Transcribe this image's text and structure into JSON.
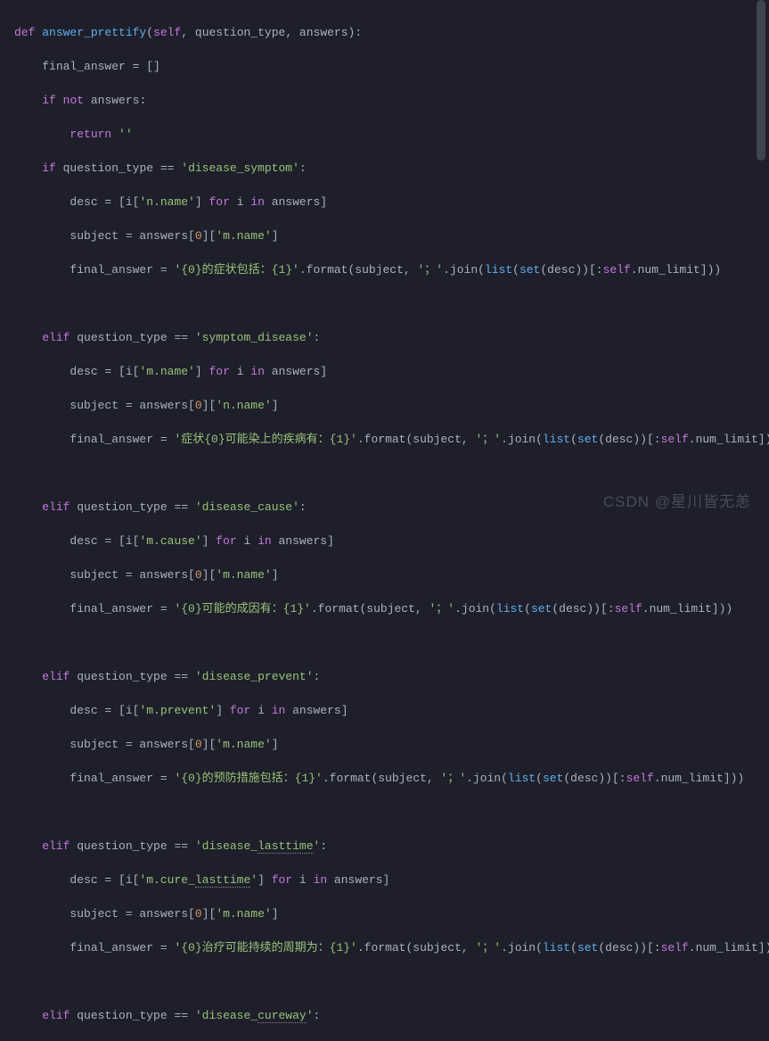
{
  "watermark": "CSDN @星川皆无恙",
  "code": {
    "def": "def",
    "fn": "answer_prettify",
    "params": {
      "self": "self",
      "qt": "question_type",
      "ans": "answers"
    },
    "l2": "final_answer = []",
    "l3a": "if",
    "l3b": "not",
    "l3c": " answers:",
    "l4a": "return",
    "l4b": "''",
    "if": "if",
    "elif": "elif",
    "case1": {
      "qt": "'disease_symptom'",
      "desc_a": "desc = [i[",
      "key": "'n.name'",
      "desc_b": "] ",
      "for": "for",
      "in": "in",
      "desc_c": " i ",
      "desc_d": " answers]",
      "subj_a": "subject = answers[",
      "zero": "0",
      "subj_b": "][",
      "mkey": "'m.name'",
      "subj_c": "]",
      "fa_a": "final_answer = ",
      "fmt": "'{0}的症状包括：{1}'",
      "fa_b": ".format(subject, ",
      "sep": "'；'",
      "fa_c": ".join(",
      "list": "list",
      "set": "set",
      "fa_d": "(desc))[:",
      "self2": "self",
      "fa_e": ".num_limit]))"
    },
    "case2": {
      "qt": "'symptom_disease'",
      "key": "'m.name'",
      "nkey": "'n.name'",
      "fmt": "'症状{0}可能染上的疾病有：{1}'"
    },
    "case3": {
      "qt": "'disease_cause'",
      "key": "'m.cause'",
      "fmt": "'{0}可能的成因有：{1}'"
    },
    "case4": {
      "qt": "'disease_prevent'",
      "key": "'m.prevent'",
      "fmt": "'{0}的预防措施包括：{1}'"
    },
    "case5": {
      "qt1": "'disease_",
      "qt2": "lasttime",
      "qt3": "'",
      "key1": "'m.cure_",
      "key2": "lasttime",
      "key3": "'",
      "fmt": "'{0}治疗可能持续的周期为：{1}'"
    },
    "case6": {
      "qt1": "'disease_",
      "qt2": "cureway",
      "qt3": "'"
    }
  }
}
